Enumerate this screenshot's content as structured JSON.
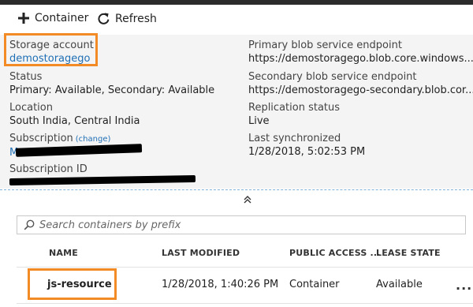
{
  "toolbar": {
    "container_label": "Container",
    "refresh_label": "Refresh",
    "icons": [
      "plus-icon",
      "refresh-icon"
    ]
  },
  "essentials": {
    "storage_account": {
      "label": "Storage account",
      "value": "demostoragego"
    },
    "status": {
      "label": "Status",
      "value": "Primary: Available, Secondary: Available"
    },
    "location": {
      "label": "Location",
      "value": "South India, Central India"
    },
    "subscription": {
      "label": "Subscription",
      "change_label": "(change)",
      "value": "M"
    },
    "subscription_id": {
      "label": "Subscription ID",
      "value": ""
    },
    "primary_endpoint": {
      "label": "Primary blob service endpoint",
      "value": "https://demostoragego.blob.core.windows...."
    },
    "secondary_endpoint": {
      "label": "Secondary blob service endpoint",
      "value": "https://demostoragego-secondary.blob.cor..."
    },
    "replication": {
      "label": "Replication status",
      "value": "Live"
    },
    "last_sync": {
      "label": "Last synchronized",
      "value": "1/28/2018, 5:02:53 PM"
    }
  },
  "search": {
    "placeholder": "Search containers by prefix"
  },
  "table": {
    "columns": [
      "NAME",
      "LAST MODIFIED",
      "PUBLIC ACCESS ...",
      "LEASE STATE"
    ],
    "rows": [
      {
        "name": "js-resource",
        "last_modified": "1/28/2018, 1:40:26 PM",
        "public_access": "Container",
        "lease_state": "Available",
        "more": "..."
      }
    ]
  },
  "colors": {
    "highlight": "#f28a26",
    "link": "#1f6fb5",
    "essentials_bg": "#f4f4f4"
  }
}
